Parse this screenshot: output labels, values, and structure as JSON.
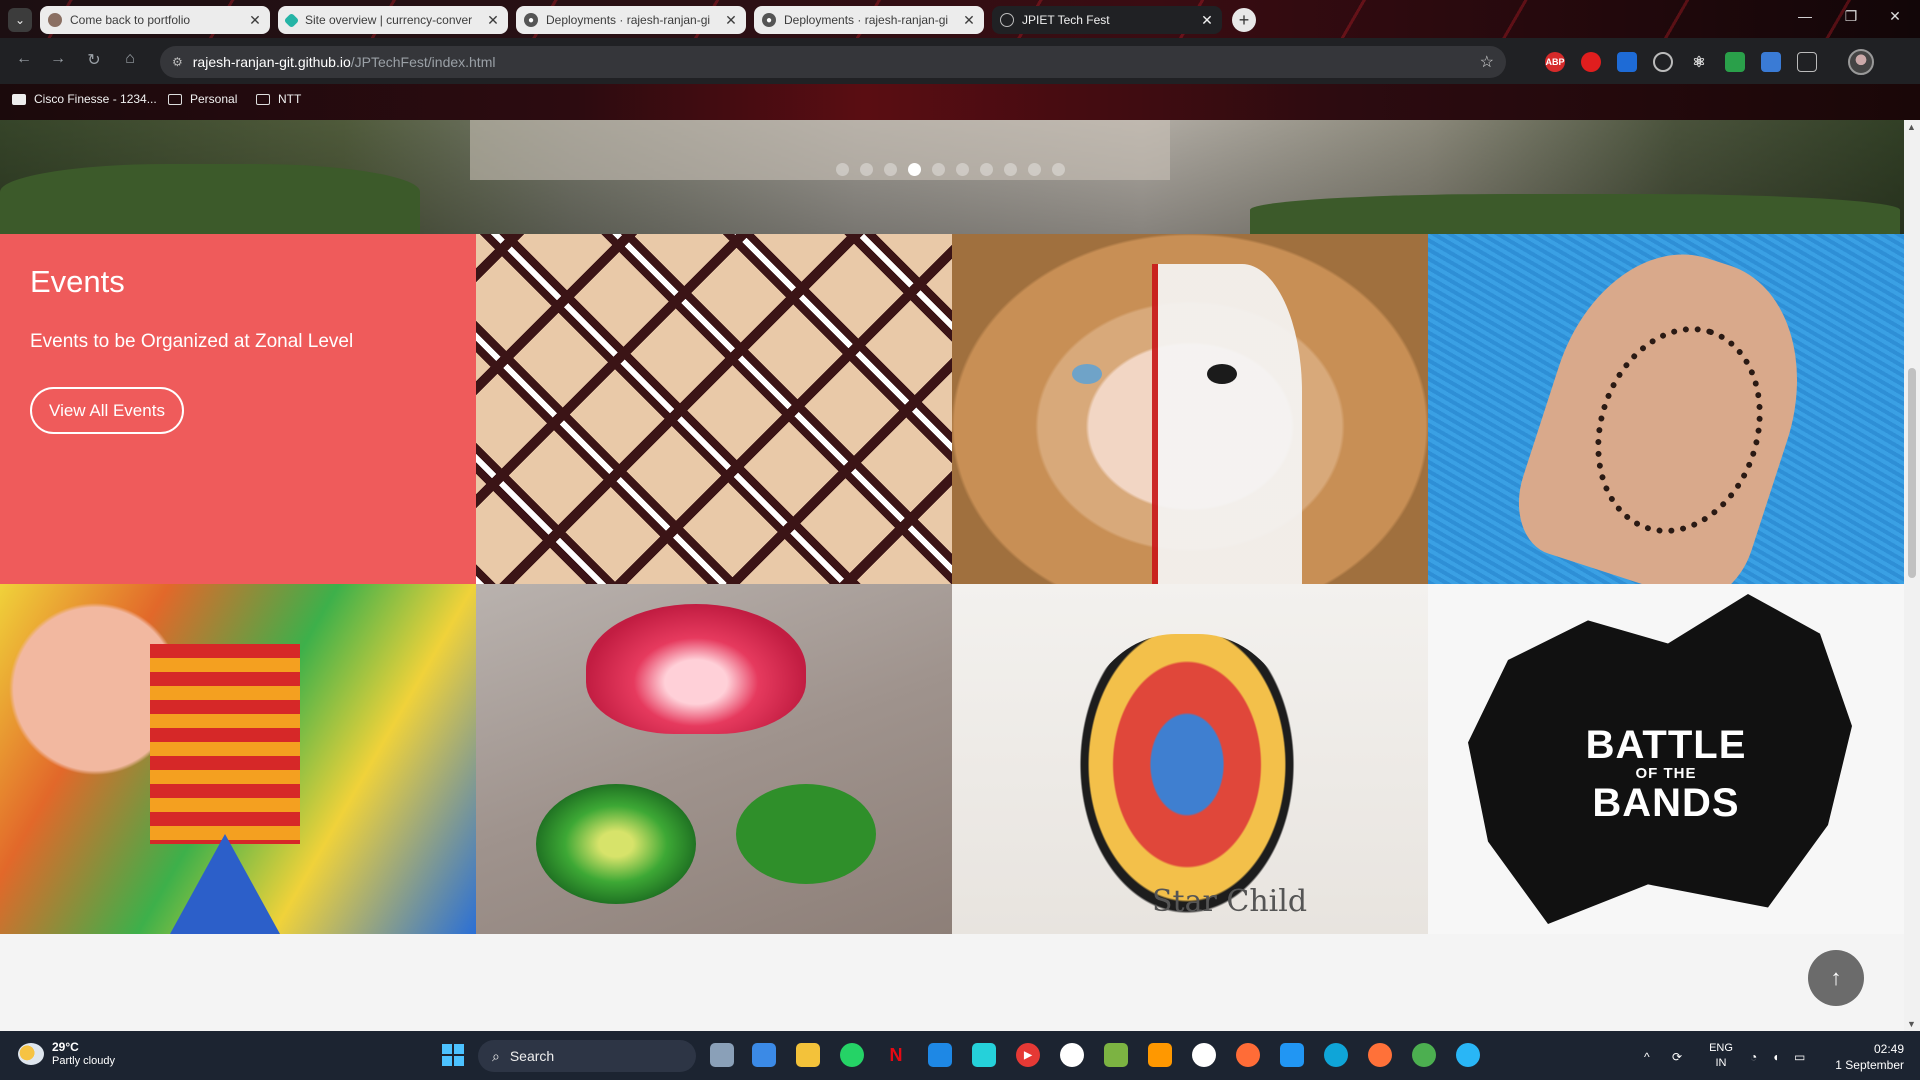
{
  "browser": {
    "tabs": [
      {
        "title": "Come back to portfolio",
        "favicon": "avatar-icon",
        "active": false
      },
      {
        "title": "Site overview | currency-conver",
        "favicon": "netlify-icon",
        "active": false
      },
      {
        "title": "Deployments · rajesh-ranjan-gi",
        "favicon": "github-icon",
        "active": false
      },
      {
        "title": "Deployments · rajesh-ranjan-gi",
        "favicon": "github-icon",
        "active": false
      },
      {
        "title": "JPIET Tech Fest",
        "favicon": "globe-icon",
        "active": true
      }
    ],
    "url_host": "rajesh-ranjan-git.github.io",
    "url_path": "/JPTechFest/index.html",
    "extensions": [
      "ABP"
    ],
    "bookmarks": [
      "Cisco Finesse - 1234...",
      "Personal",
      "NTT"
    ]
  },
  "page": {
    "events": {
      "title": "Events",
      "subtitle": "Events to be Organized at Zonal Level",
      "button": "View All Events"
    },
    "carousel": {
      "count": 10,
      "active_index": 3
    },
    "images": [
      {
        "subject": "family photo collage",
        "name": "collage"
      },
      {
        "subject": "face painting",
        "name": "face-paint"
      },
      {
        "subject": "mehendi henna",
        "name": "henna"
      },
      {
        "subject": "poster painting",
        "name": "poster"
      },
      {
        "subject": "rangoli lotus",
        "name": "rangoli"
      },
      {
        "subject": "t-shirt painting",
        "name": "tshirt"
      },
      {
        "subject": "battle of the bands",
        "name": "bands"
      }
    ],
    "bands_text": {
      "line1": "BATTLE",
      "line2": "OF THE",
      "line3": "BANDS"
    },
    "shirt_text": "Star Child"
  },
  "taskbar": {
    "weather_temp": "29°C",
    "weather_desc": "Partly cloudy",
    "search_placeholder": "Search",
    "lang1": "ENG",
    "lang2": "IN",
    "time": "02:49",
    "date": "1 September"
  }
}
